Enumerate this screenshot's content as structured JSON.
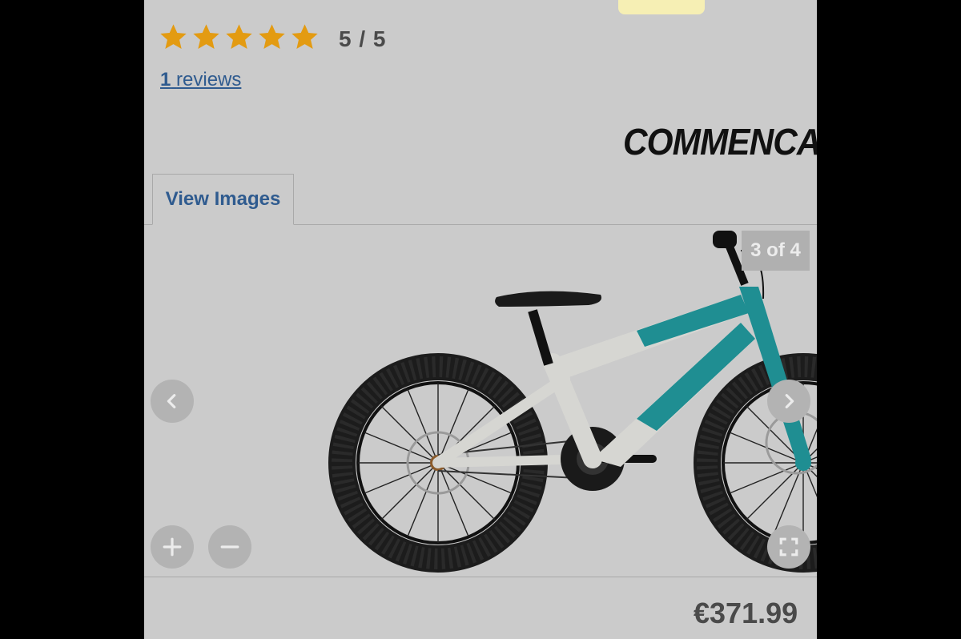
{
  "rating": {
    "stars_filled": 5,
    "stars_total": 5,
    "text": "5 / 5",
    "star_color": "#e39b12"
  },
  "reviews": {
    "count": "1",
    "label": "reviews"
  },
  "brand": {
    "name": "COMMENCAL"
  },
  "tabs": {
    "view_images": "View Images"
  },
  "gallery": {
    "counter": "3 of 4",
    "prev_icon": "chevron-left-icon",
    "next_icon": "chevron-right-icon",
    "zoom_in_icon": "plus-icon",
    "zoom_out_icon": "minus-icon",
    "fullscreen_icon": "fullscreen-icon"
  },
  "product": {
    "price": "€371.99",
    "frame_color": "#1f8e92",
    "frame_secondary_color": "#d6d6d2"
  }
}
